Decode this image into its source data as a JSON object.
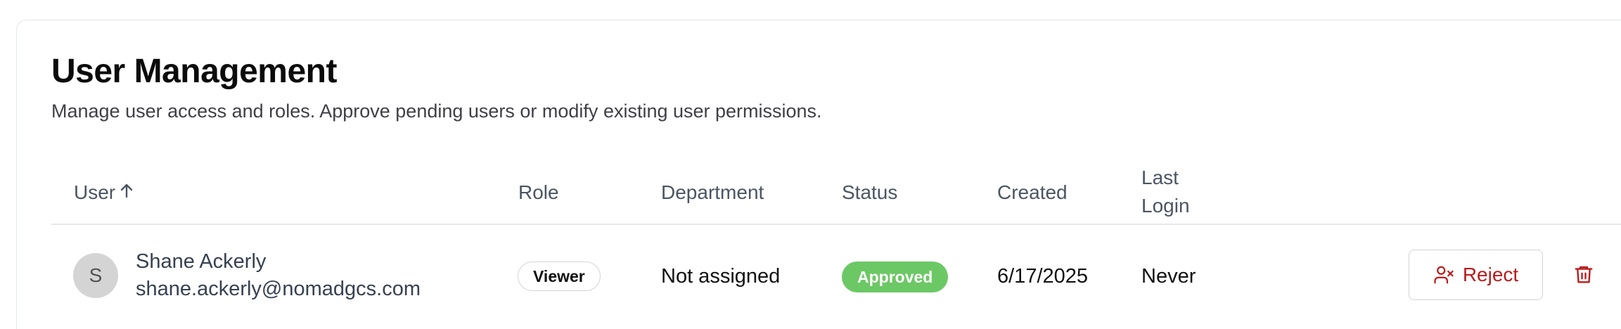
{
  "header": {
    "title": "User Management",
    "subtitle": "Manage user access and roles. Approve pending users or modify existing user permissions."
  },
  "table": {
    "columns": {
      "user": "User",
      "role": "Role",
      "department": "Department",
      "status": "Status",
      "created": "Created",
      "last_login_line1": "Last",
      "last_login_line2": "Login"
    },
    "sort": {
      "column": "User",
      "direction": "ascending",
      "icon": "arrow-up-icon"
    },
    "rows": [
      {
        "avatar_initial": "S",
        "name": "Shane Ackerly",
        "email": "shane.ackerly@nomadgcs.com",
        "role": "Viewer",
        "department": "Not assigned",
        "status": "Approved",
        "created": "6/17/2025",
        "last_login": "Never",
        "actions": {
          "reject_label": "Reject",
          "reject_icon": "user-x-icon",
          "delete_icon": "trash-icon"
        }
      }
    ]
  },
  "colors": {
    "status_approved": "#6cc865",
    "danger": "#b91c1c",
    "border": "#e5e7eb"
  }
}
